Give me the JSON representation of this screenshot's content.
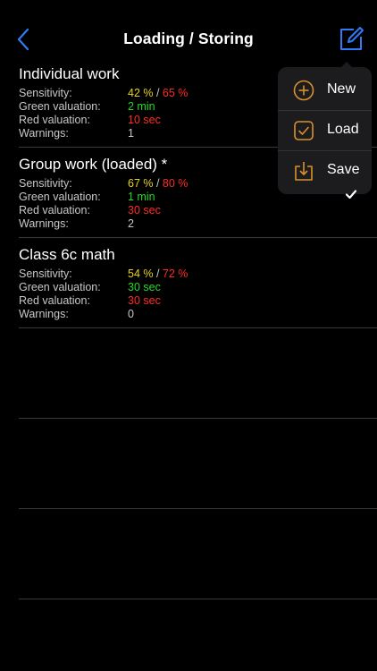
{
  "nav": {
    "title": "Loading / Storing",
    "back_icon": "chevron-left-icon",
    "edit_icon": "compose-icon",
    "accent_color": "#2f7cf6"
  },
  "entries": [
    {
      "name": "Individual work",
      "sensitivity_label": "Sensitivity:",
      "sensitivity_green": "42 %",
      "sensitivity_sep": " / ",
      "sensitivity_red": "65 %",
      "green_label": "Green valuation:",
      "green_value": "2 min",
      "red_label": "Red valuation:",
      "red_value": "10 sec",
      "warnings_label": "Warnings:",
      "warnings_value": "1"
    },
    {
      "name": "Group work (loaded) *",
      "sensitivity_label": "Sensitivity:",
      "sensitivity_green": "67 %",
      "sensitivity_sep": " / ",
      "sensitivity_red": "80 %",
      "green_label": "Green valuation:",
      "green_value": "1 min",
      "red_label": "Red valuation:",
      "red_value": "30 sec",
      "warnings_label": "Warnings:",
      "warnings_value": "2"
    },
    {
      "name": "Class 6c math",
      "sensitivity_label": "Sensitivity:",
      "sensitivity_green": "54 %",
      "sensitivity_sep": " / ",
      "sensitivity_red": "72 %",
      "green_label": "Green valuation:",
      "green_value": "30 sec",
      "red_label": "Red valuation:",
      "red_value": "30 sec",
      "warnings_label": "Warnings:",
      "warnings_value": "0"
    }
  ],
  "menu": {
    "new_label": "New",
    "load_label": "Load",
    "save_label": "Save",
    "new_icon": "plus-circle-icon",
    "load_icon": "checkbox-icon",
    "save_icon": "download-icon",
    "icon_color": "#d9912a"
  },
  "colors": {
    "yellow": "#e6d31e",
    "red": "#ff2b24",
    "green": "#26d926"
  }
}
